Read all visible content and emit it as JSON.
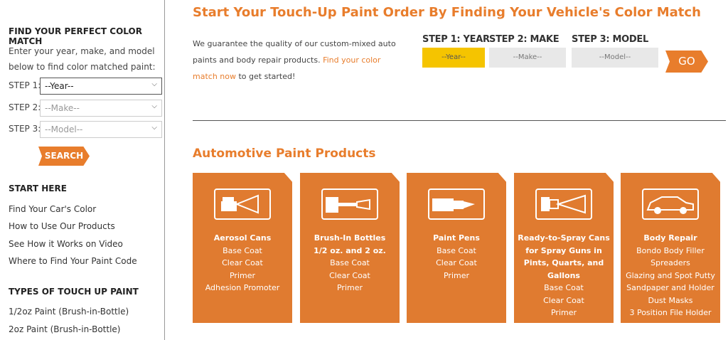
{
  "sidebar": {
    "find_heading": "FIND YOUR PERFECT COLOR MATCH",
    "find_text_1": "Enter your year, make, and model",
    "find_text_2": "below to find color matched paint:",
    "steps": [
      {
        "label": "STEP 1:",
        "value": "--Year--"
      },
      {
        "label": "STEP 2:",
        "value": "--Make--"
      },
      {
        "label": "STEP 3:",
        "value": "--Model--"
      }
    ],
    "search_label": "SEARCH",
    "start_heading": "START HERE",
    "start_links": [
      "Find Your Car's Color",
      "How to Use Our Products",
      "See How it Works on Video",
      "Where to Find Your Paint Code"
    ],
    "types_heading": "TYPES OF TOUCH UP PAINT",
    "types_links": [
      "1/2oz Paint (Brush-in-Bottle)",
      "2oz Paint (Brush-in-Bottle)"
    ]
  },
  "main": {
    "title": "Start Your Touch-Up Paint Order By Finding Your Vehicle's Color Match",
    "intro_1": "We guarantee the quality of our custom-mixed auto",
    "intro_2": "paints and body repair products.",
    "intro_link": "Find your color match now",
    "intro_3": "to get started!",
    "steps": [
      {
        "label": "STEP 1: YEAR",
        "value": "--Year--"
      },
      {
        "label": "STEP 2: MAKE",
        "value": "--Make--"
      },
      {
        "label": "STEP 3: MODEL",
        "value": "--Model--"
      }
    ],
    "go_label": "GO",
    "products_title": "Automotive Paint Products",
    "cards": [
      {
        "icon": "aerosol-can-icon",
        "bold": [
          "Aerosol Cans"
        ],
        "items": [
          "Base Coat",
          "Clear Coat",
          "Primer",
          "Adhesion Promoter"
        ]
      },
      {
        "icon": "brush-bottle-icon",
        "bold": [
          "Brush-In Bottles",
          "1/2 oz. and 2 oz."
        ],
        "items": [
          "Base Coat",
          "Clear Coat",
          "Primer"
        ]
      },
      {
        "icon": "paint-pen-icon",
        "bold": [
          "Paint Pens"
        ],
        "items": [
          "Base Coat",
          "Clear Coat",
          "Primer"
        ]
      },
      {
        "icon": "spray-gun-icon",
        "bold": [
          "Ready-to-Spray Cans",
          "for Spray Guns in",
          "Pints, Quarts, and",
          "Gallons"
        ],
        "items": [
          "Base Coat",
          "Clear Coat",
          "Primer"
        ]
      },
      {
        "icon": "car-icon",
        "bold": [
          "Body Repair"
        ],
        "items": [
          "Bondo Body Filler",
          "Spreaders",
          "Glazing and Spot Putty",
          "Sandpaper and Holder",
          "Dust Masks",
          "3 Position File Holder"
        ]
      }
    ]
  },
  "colors": {
    "accent": "#e87d2c",
    "card": "#e07b30",
    "year_highlight": "#f5c400"
  }
}
